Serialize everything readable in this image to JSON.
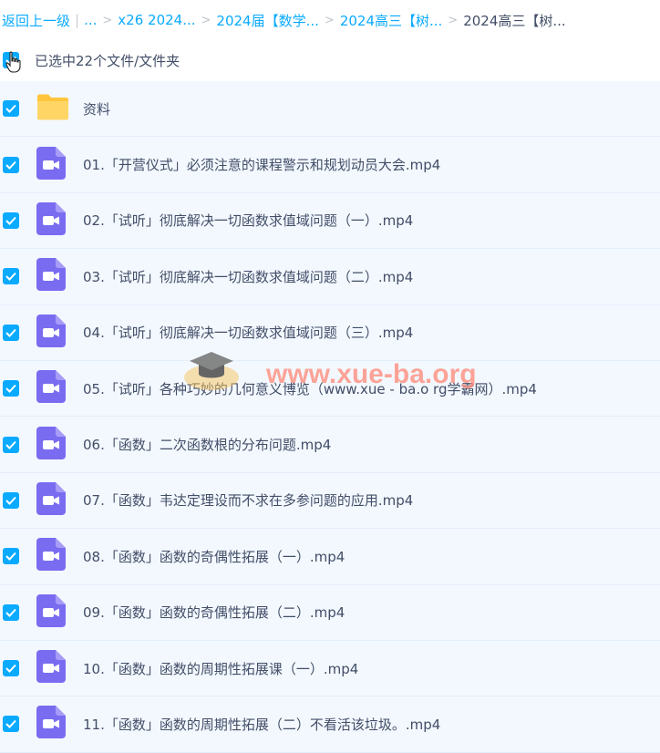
{
  "breadcrumb": {
    "back": "返回上一级",
    "ellipsis": "...",
    "items": [
      "x26 2024...",
      "2024届【数学...",
      "2024高三【树..."
    ],
    "current": "2024高三【树...",
    "separator": ">"
  },
  "selection": {
    "label": "已选中22个文件/文件夹"
  },
  "files": [
    {
      "name": "资料",
      "type": "folder"
    },
    {
      "name": "01.「开营仪式」必须注意的课程警示和规划动员大会.mp4",
      "type": "video"
    },
    {
      "name": "02.「试听」彻底解决一切函数求值域问题（一）.mp4",
      "type": "video"
    },
    {
      "name": "03.「试听」彻底解决一切函数求值域问题（二）.mp4",
      "type": "video"
    },
    {
      "name": "04.「试听」彻底解决一切函数求值域问题（三）.mp4",
      "type": "video"
    },
    {
      "name": "05.「试听」各种巧妙的几何意义博览（www.xue - ba.o rg学霸网）.mp4",
      "type": "video"
    },
    {
      "name": "06.「函数」二次函数根的分布问题.mp4",
      "type": "video"
    },
    {
      "name": "07.「函数」韦达定理设而不求在多参问题的应用.mp4",
      "type": "video"
    },
    {
      "name": "08.「函数」函数的奇偶性拓展（一）.mp4",
      "type": "video"
    },
    {
      "name": "09.「函数」函数的奇偶性拓展（二）.mp4",
      "type": "video"
    },
    {
      "name": "10.「函数」函数的周期性拓展课（一）.mp4",
      "type": "video"
    },
    {
      "name": "11.「函数」函数的周期性拓展（二）不看活该垃圾。.mp4",
      "type": "video"
    }
  ],
  "watermark": "www.xue-ba.org",
  "colors": {
    "accent": "#09aaff",
    "video_icon": "#7a6cf0",
    "folder": "#ffc53d",
    "row_bg": "#f3f8ff",
    "text": "#424e67"
  }
}
